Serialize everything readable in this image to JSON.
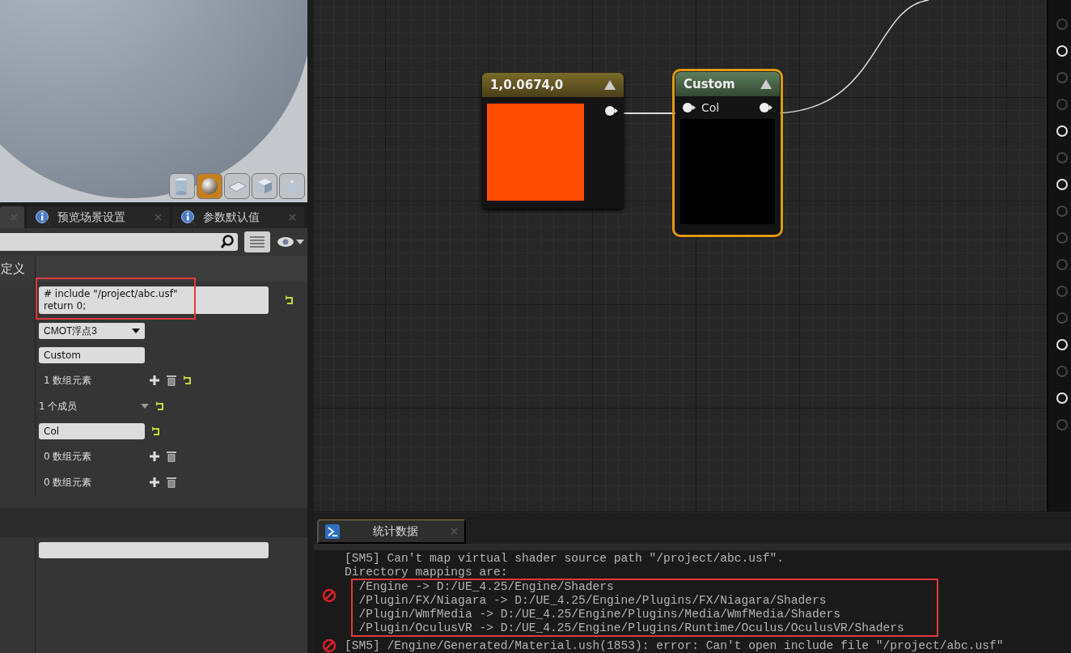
{
  "preview": {
    "shapes": [
      {
        "kind": "cylinder",
        "selected": false
      },
      {
        "kind": "sphere",
        "selected": true
      },
      {
        "kind": "plane",
        "selected": false
      },
      {
        "kind": "cube",
        "selected": false
      },
      {
        "kind": "teapot",
        "selected": false
      }
    ]
  },
  "panel_tabs": [
    {
      "selected": true
    },
    {
      "label": "预览场景设置",
      "selected": false
    },
    {
      "label": "参数默认值",
      "selected": false
    }
  ],
  "details": {
    "section": "定义",
    "rows": [
      {
        "kind": "code",
        "value": "# include \"/project/abc.usf\"\nreturn 0;",
        "reset": true,
        "highlighted": true
      },
      {
        "kind": "dropdown",
        "value": "CMOT浮点3"
      },
      {
        "kind": "text",
        "value": "Custom"
      },
      {
        "kind": "array",
        "value": "1 数组元素",
        "add": true,
        "delete": true,
        "reset": true
      },
      {
        "kind": "members",
        "value": "1 个成员",
        "reset": true
      },
      {
        "kind": "text",
        "value": "Col",
        "reset": true
      },
      {
        "kind": "array",
        "value": "0 数组元素",
        "add": true,
        "delete": true
      },
      {
        "kind": "array",
        "value": "0 数组元素",
        "add": true,
        "delete": true
      }
    ],
    "footer_rows": [
      {
        "kind": "wide-text"
      }
    ]
  },
  "graph": {
    "nodes": [
      {
        "kind": "constant",
        "title": "1,0.0674,0",
        "color": "#ff4d00",
        "selected": false
      },
      {
        "kind": "custom",
        "title": "Custom",
        "inputs": [
          "Col"
        ],
        "selected": true
      }
    ],
    "result_pins": [
      {
        "connected": false
      },
      {
        "connected": true
      },
      {
        "connected": false
      },
      {
        "connected": false
      },
      {
        "connected": true
      },
      {
        "connected": false
      },
      {
        "connected": true
      },
      {
        "connected": false
      },
      {
        "connected": false
      },
      {
        "connected": false
      },
      {
        "connected": false
      },
      {
        "connected": false
      },
      {
        "connected": true
      },
      {
        "connected": false
      },
      {
        "connected": true
      },
      {
        "connected": false
      }
    ]
  },
  "log_panel": {
    "tab": "统计数据",
    "entries": [
      {
        "kind": "error",
        "lines": [
          "[SM5] Can't map virtual shader source path \"/project/abc.usf\".",
          "Directory mappings are:"
        ],
        "highlighted_lines": [
          "  /Engine -> D:/UE_4.25/Engine/Shaders",
          "  /Plugin/FX/Niagara -> D:/UE_4.25/Engine/Plugins/FX/Niagara/Shaders",
          "  /Plugin/WmfMedia -> D:/UE_4.25/Engine/Plugins/Media/WmfMedia/Shaders",
          "  /Plugin/OculusVR -> D:/UE_4.25/Engine/Plugins/Runtime/Oculus/OculusVR/Shaders"
        ]
      },
      {
        "kind": "error",
        "lines": [
          "[SM5] /Engine/Generated/Material.ush(1853): error: Can't open include file \"/project/abc.usf\""
        ]
      }
    ]
  }
}
